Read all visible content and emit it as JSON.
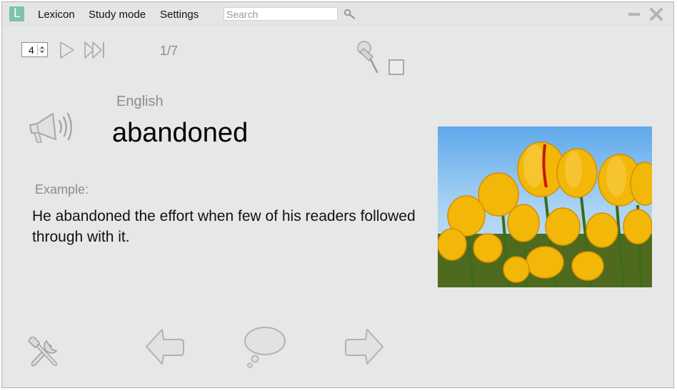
{
  "app": {
    "logo_letter": "L"
  },
  "menu": {
    "items": [
      "Lexicon",
      "Study mode",
      "Settings"
    ]
  },
  "search": {
    "placeholder": "Search",
    "value": ""
  },
  "playback": {
    "repeat_count": "4",
    "counter": "1/7"
  },
  "card": {
    "language": "English",
    "word": "abandoned",
    "example_label": "Example:",
    "example_text": "He abandoned the effort when few of his readers followed through with it."
  },
  "colors": {
    "logo": "#7fc3a6",
    "background": "#e6e7e7",
    "icon_grey": "#a9a9a9"
  },
  "icons": [
    "logo-icon",
    "search-icon",
    "minimize-icon",
    "close-icon",
    "play-icon",
    "skip-forward-icon",
    "pin-icon",
    "speaker-icon",
    "tools-icon",
    "back-arrow-icon",
    "speech-bubble-icon",
    "forward-arrow-icon"
  ]
}
